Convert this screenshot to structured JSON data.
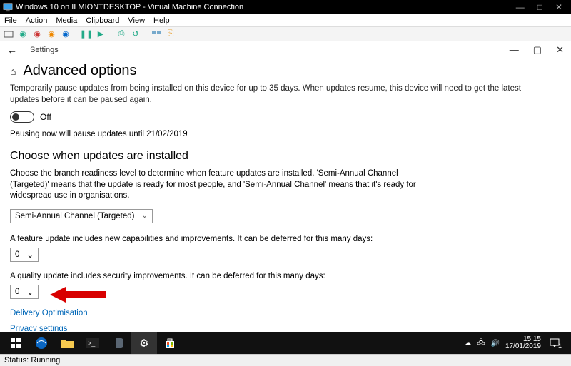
{
  "vm": {
    "title": "Windows 10 on ILMIONTDESKTOP - Virtual Machine Connection",
    "menu": [
      "File",
      "Action",
      "Media",
      "Clipboard",
      "View",
      "Help"
    ],
    "status_label": "Status:",
    "status_value": "Running"
  },
  "settings": {
    "app_name": "Settings",
    "page_title": "Advanced options",
    "pause_desc": "Temporarily pause updates from being installed on this device for up to 35 days. When updates resume, this device will need to get the latest updates before it can be paused again.",
    "toggle_state": "Off",
    "pause_until": "Pausing now will pause updates until 21/02/2019",
    "choose_heading": "Choose when updates are installed",
    "choose_desc": "Choose the branch readiness level to determine when feature updates are installed. 'Semi-Annual Channel (Targeted)' means that the update is ready for most people, and 'Semi-Annual Channel' means that it's ready for widespread use in organisations.",
    "branch_value": "Semi-Annual Channel (Targeted)",
    "feature_label": "A feature update includes new capabilities and improvements. It can be deferred for this many days:",
    "feature_days": "0",
    "quality_label": "A quality update includes security improvements. It can be deferred for this many days:",
    "quality_days": "0",
    "link_delivery": "Delivery Optimisation",
    "link_privacy": "Privacy settings"
  },
  "taskbar": {
    "time": "15:15",
    "date": "17/01/2019",
    "notif_count": "1"
  }
}
